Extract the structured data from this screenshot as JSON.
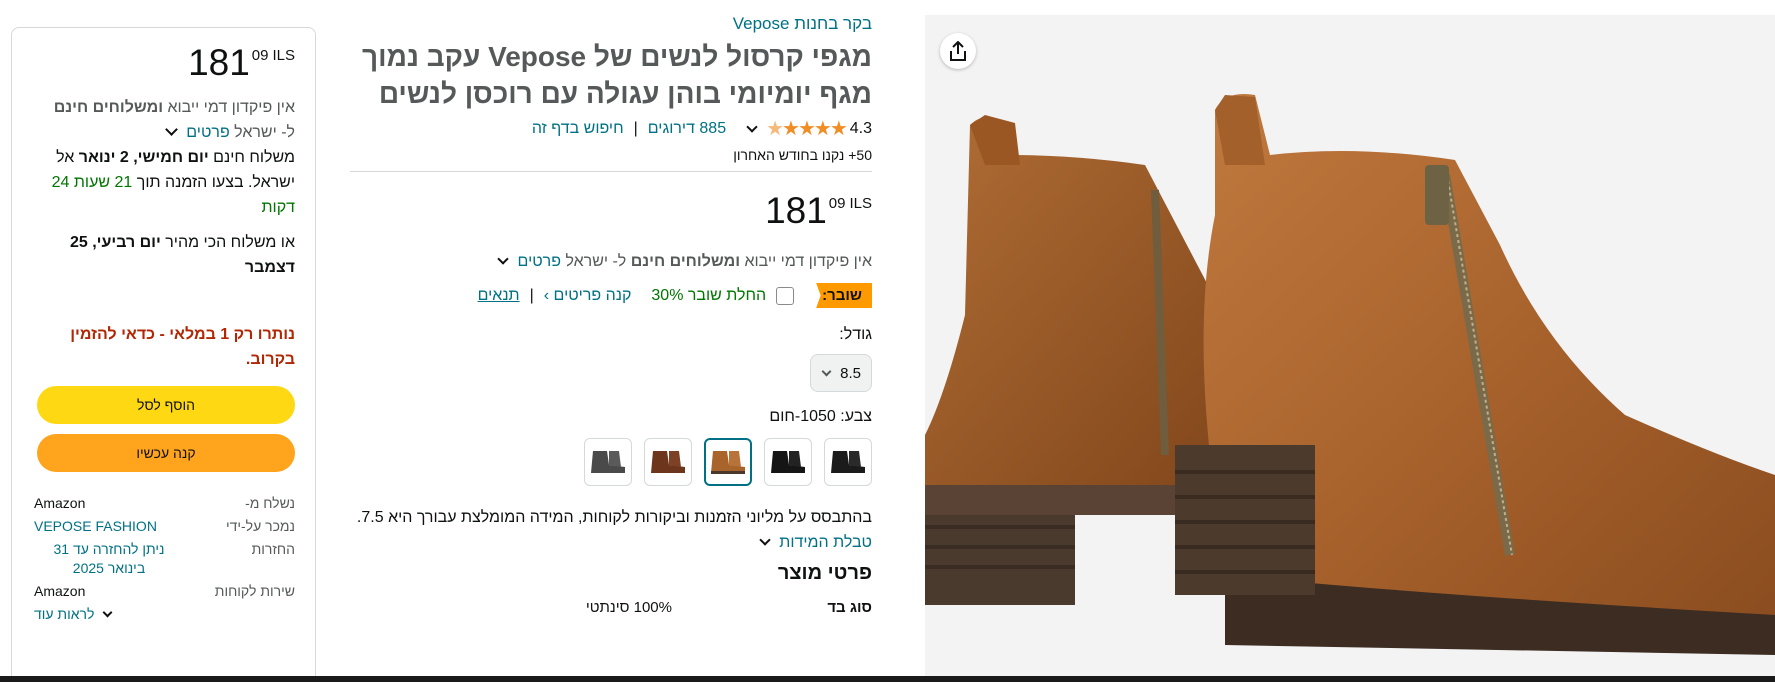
{
  "price": {
    "whole": "181",
    "fraction": "09",
    "currency": "ILS"
  },
  "buybox": {
    "import_fees_prefix": "אין פיקדון דמי ייבוא",
    "free_shipping_bold": "ומשלוחים חינם",
    "to_israel": "ל- ישראל",
    "details_link": "פרטים",
    "delivery_prefix": "משלוח חינם",
    "delivery_date": "יום חמישי, 2 ינואר",
    "delivery_to": "אל ישראל. בצעו הזמנה תוך",
    "countdown": "21 שעות 24 דקות",
    "fastest_prefix": "או משלוח הכי מהיר",
    "fastest_date": "יום רביעי, 25 דצמבר",
    "stock_warning": "נותרו רק 1 במלאי - כדאי להזמין בקרוב.",
    "add_to_cart": "הוסף לסל",
    "buy_now": "קנה עכשיו",
    "info": [
      {
        "label": "נשלח מ-",
        "value": "Amazon",
        "link": false
      },
      {
        "label": "נמכר על-ידי",
        "value": "VEPOSE FASHION",
        "link": true
      },
      {
        "label": "החזרות",
        "value": "ניתן להחזרה עד 31 בינואר 2025",
        "link": true
      },
      {
        "label": "שירות לקוחות",
        "value": "Amazon",
        "link": false
      }
    ],
    "see_more": "לראות עוד"
  },
  "detail": {
    "store_link": "בקר בחנות Vepose",
    "title": "מגפי קרסול לנשים של Vepose עקב נמוך מגף יומיומי בוהן עגולה עם רוכסן לנשים",
    "rating": "4.3",
    "ratings_count": "885 דירוגים",
    "search_page": "חיפוש בדף זה",
    "bought": "50+ נקנו בחודש האחרון",
    "import_fees_prefix": "אין פיקדון דמי ייבוא",
    "free_shipping_bold": "ומשלוחים חינם",
    "to_israel": "ל- ישראל",
    "details_link": "פרטים",
    "coupon_tag": "שובר:",
    "coupon_text": "החלת שובר 30%",
    "coupon_shop": "קנה פריטים ›",
    "coupon_terms": "תנאים",
    "size_label": "גודל:",
    "size_value": "8.5",
    "color_label": "צבע:",
    "color_value": "1050-חום",
    "recommendation": "בהתבסס על מליוני הזמנות וביקורות לקוחות, המידה המומלצת עבורך היא 7.5.",
    "size_chart": "טבלת המידות",
    "product_details_title": "פרטי מוצר",
    "spec_key": "סוג בד",
    "spec_value": "100% סינתטי"
  },
  "swatches": [
    "black-1",
    "black-2",
    "tan-selected",
    "brown",
    "grey"
  ],
  "colors": {
    "link": "#007185",
    "star": "#f08d24",
    "cart": "#ffd814",
    "buy": "#ffa41c",
    "stock": "#b12704",
    "green": "#007600"
  }
}
